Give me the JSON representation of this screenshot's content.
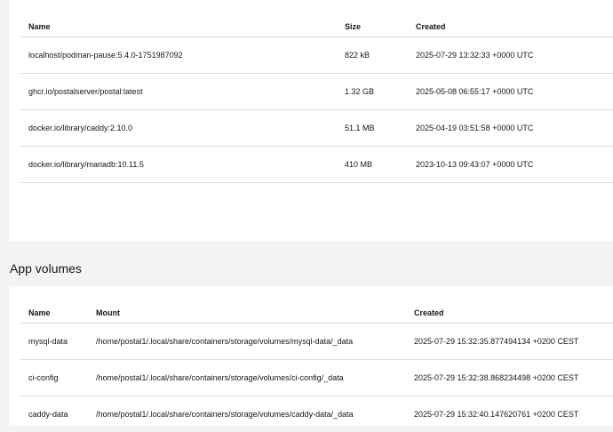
{
  "images": {
    "columns": {
      "name": "Name",
      "size": "Size",
      "created": "Created"
    },
    "rows": [
      {
        "name": "localhost/podman-pause:5.4.0-1751987092",
        "size": "822 kB",
        "created": "2025-07-29 13:32:33 +0000 UTC"
      },
      {
        "name": "ghcr.io/postalserver/postal:latest",
        "size": "1.32 GB",
        "created": "2025-05-08 06:55:17 +0000 UTC"
      },
      {
        "name": "docker.io/library/caddy:2.10.0",
        "size": "51.1 MB",
        "created": "2025-04-19 03:51:58 +0000 UTC"
      },
      {
        "name": "docker.io/library/mariadb:10.11.5",
        "size": "410 MB",
        "created": "2023-10-13 09:43:07 +0000 UTC"
      }
    ]
  },
  "volumes": {
    "title": "App volumes",
    "columns": {
      "name": "Name",
      "mount": "Mount",
      "created": "Created"
    },
    "rows": [
      {
        "name": "mysql-data",
        "mount": "/home/postal1/.local/share/containers/storage/volumes/mysql-data/_data",
        "created": "2025-07-29 15:32:35.877494134 +0200 CEST"
      },
      {
        "name": "ci-config",
        "mount": "/home/postal1/.local/share/containers/storage/volumes/ci-config/_data",
        "created": "2025-07-29 15:32:38.868234498 +0200 CEST"
      },
      {
        "name": "caddy-data",
        "mount": "/home/postal1/.local/share/containers/storage/volumes/caddy-data/_data",
        "created": "2025-07-29 15:32:40.147620761 +0200 CEST"
      }
    ]
  }
}
